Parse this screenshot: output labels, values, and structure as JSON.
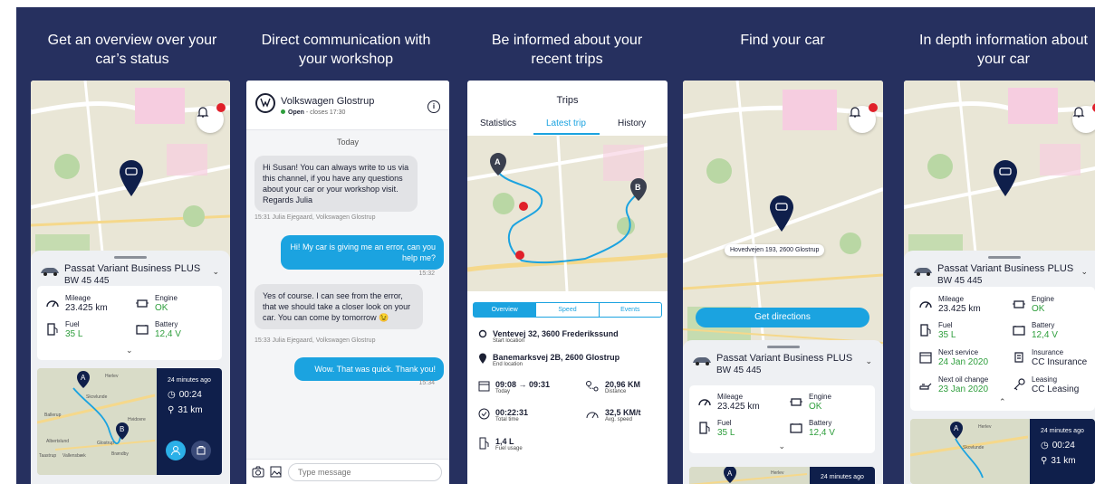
{
  "headings": [
    "Get an overview over your car’s status",
    "Direct communication with your workshop",
    "Be informed about your recent trips",
    "Find your car",
    "In depth information about your car"
  ],
  "colors": {
    "banner": "#26305f",
    "accent": "#1ba3e0",
    "ok": "#2e9e3c",
    "pin": "#0f1f4b",
    "notification": "#e0202a"
  },
  "car": {
    "name": "Passat Variant Business PLUS",
    "plate": "BW 45 445",
    "stats": {
      "mileage_label": "Mileage",
      "mileage_value": "23.425 km",
      "engine_label": "Engine",
      "engine_value": "OK",
      "fuel_label": "Fuel",
      "fuel_value": "35 L",
      "battery_label": "Battery",
      "battery_value": "12,4 V"
    }
  },
  "mini_trip": {
    "ago": "24 minutes ago",
    "time": "00:24",
    "distance": "31 km",
    "pin_a": "A",
    "pin_b": "B"
  },
  "mini_map_labels": [
    "Herlev",
    "Skovlunde",
    "Ballerup",
    "Albertslund",
    "Glostrup",
    "Taastrup",
    "Vallensbæk",
    "Hvidovre",
    "Brøndby"
  ],
  "chat": {
    "workshop": "Volkswagen Glostrup",
    "status_open": "Open",
    "status_hours": "- closes 17:30",
    "info_icon": "i",
    "today": "Today",
    "messages": [
      {
        "text": "Hi Susan! You can always write to us via this channel, if you have any questions about your car or your workshop visit. Regards Julia",
        "meta": "15:31 Julia Ejegaard, Volkswagen Glostrup"
      },
      {
        "text": "Hi! My car is giving me an error, can you help me?",
        "meta": "15:32"
      },
      {
        "text": "Yes of course. I can see from the error, that we should take a closer look on your car. You can come by tomorrow 😉",
        "meta": "15:33 Julia Ejegaard, Volkswagen Glostrup"
      },
      {
        "text": "Wow. That was quick. Thank you!",
        "meta": "15:34"
      }
    ],
    "placeholder": "Type message"
  },
  "trips": {
    "title": "Trips",
    "tabs": [
      "Statistics",
      "Latest trip",
      "History"
    ],
    "pin_a": "A",
    "pin_b": "B",
    "segments": [
      "Overview",
      "Speed",
      "Events"
    ],
    "start_address": "Ventevej 32, 3600 Frederikssund",
    "start_label": "Start location",
    "end_address": "Banemarksvej 2B, 2600 Glostrup",
    "end_label": "End location",
    "time_range": "09:08 → 09:31",
    "time_sub": "Today",
    "distance": "20,96 KM",
    "distance_sub": "Distance",
    "total_time": "00:22:31",
    "total_time_sub": "Total time",
    "avg_speed": "32,5 KM/t",
    "avg_speed_sub": "Avg. speed",
    "fuel": "1,4 L",
    "fuel_sub": "Fuel usage"
  },
  "find": {
    "address": "Hovedvejen 193, 2600 Glostrup",
    "directions": "Get directions"
  },
  "details": {
    "next_service_label": "Next service",
    "next_service_value": "24 Jan 2020",
    "insurance_label": "Insurance",
    "insurance_value": "CC Insurance",
    "oil_label": "Next oil change",
    "oil_value": "23 Jan 2020",
    "leasing_label": "Leasing",
    "leasing_value": "CC Leasing"
  },
  "icons": [
    "bell-icon",
    "car-pin-icon",
    "speedometer-icon",
    "engine-icon",
    "fuel-icon",
    "battery-icon",
    "chevron-down-icon",
    "clock-icon",
    "route-icon",
    "user-icon",
    "workshop-icon",
    "camera-icon",
    "gallery-icon",
    "info-icon",
    "calendar-icon",
    "insurance-icon",
    "oil-icon",
    "key-icon"
  ]
}
